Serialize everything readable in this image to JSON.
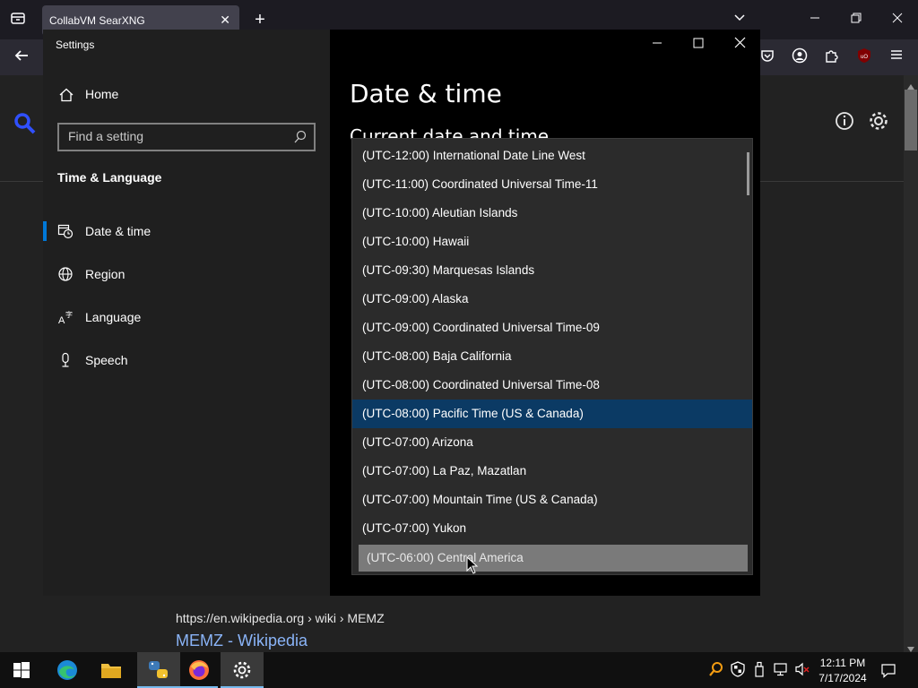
{
  "browser": {
    "tab_title": "CollabVM SearXNG",
    "tab_close": "✕",
    "new_tab": "+"
  },
  "settings": {
    "window_title": "Settings",
    "home_label": "Home",
    "search_placeholder": "Find a setting",
    "section_heading": "Time & Language",
    "nav": [
      {
        "label": "Date & time",
        "icon": "date-time-icon"
      },
      {
        "label": "Region",
        "icon": "globe-icon"
      },
      {
        "label": "Language",
        "icon": "language-icon"
      },
      {
        "label": "Speech",
        "icon": "microphone-icon"
      }
    ],
    "page_heading": "Date & time",
    "sub_heading": "Current date and time"
  },
  "timezone_dropdown": {
    "items": [
      "(UTC-12:00) International Date Line West",
      "(UTC-11:00) Coordinated Universal Time-11",
      "(UTC-10:00) Aleutian Islands",
      "(UTC-10:00) Hawaii",
      "(UTC-09:30) Marquesas Islands",
      "(UTC-09:00) Alaska",
      "(UTC-09:00) Coordinated Universal Time-09",
      "(UTC-08:00) Baja California",
      "(UTC-08:00) Coordinated Universal Time-08",
      "(UTC-08:00) Pacific Time (US & Canada)",
      "(UTC-07:00) Arizona",
      "(UTC-07:00) La Paz, Mazatlan",
      "(UTC-07:00) Mountain Time (US & Canada)",
      "(UTC-07:00) Yukon",
      "(UTC-06:00) Central America"
    ],
    "selected_index": 9,
    "hover_index": 14
  },
  "search_result": {
    "url": "https://en.wikipedia.org  › wiki › MEMZ",
    "title": "MEMZ - Wikipedia"
  },
  "taskbar": {
    "time": "12:11 PM",
    "date": "7/17/2024"
  },
  "colors": {
    "accent": "#0078d7",
    "selected_row": "#0b3a64",
    "hover_row": "#7a7a7a",
    "link": "#8ab4f8"
  }
}
